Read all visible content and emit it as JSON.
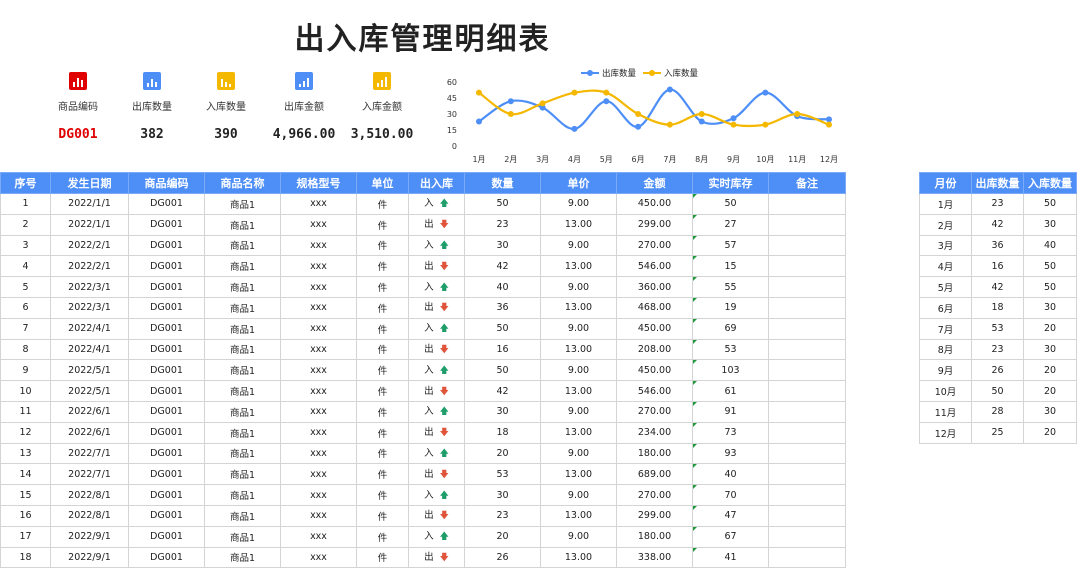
{
  "title": "出入库管理明细表",
  "kpis": [
    {
      "label": "商品编码",
      "value": "DG001",
      "color": "#e00000"
    },
    {
      "label": "出库数量",
      "value": "382",
      "color": "#4d8ef7"
    },
    {
      "label": "入库数量",
      "value": "390",
      "color": "#f5b800"
    },
    {
      "label": "出库金额",
      "value": "4,966.00",
      "color": "#4d8ef7"
    },
    {
      "label": "入库金额",
      "value": "3,510.00",
      "color": "#f5b800"
    }
  ],
  "chart_data": {
    "type": "line",
    "categories": [
      "1月",
      "2月",
      "3月",
      "4月",
      "5月",
      "6月",
      "7月",
      "8月",
      "9月",
      "10月",
      "11月",
      "12月"
    ],
    "series": [
      {
        "name": "出库数量",
        "color": "#4d8ef7",
        "values": [
          23,
          42,
          36,
          16,
          42,
          18,
          53,
          23,
          26,
          50,
          28,
          25
        ]
      },
      {
        "name": "入库数量",
        "color": "#f5b800",
        "values": [
          50,
          30,
          40,
          50,
          50,
          30,
          20,
          30,
          20,
          20,
          30,
          20
        ]
      }
    ],
    "yticks": [
      "60",
      "45",
      "30",
      "15",
      "0"
    ],
    "ylim": [
      0,
      60
    ],
    "legend": "top"
  },
  "table": {
    "headers": [
      "序号",
      "发生日期",
      "商品编码",
      "商品名称",
      "规格型号",
      "单位",
      "出入库",
      "数量",
      "单价",
      "金额",
      "实时库存",
      "备注"
    ],
    "rows": [
      [
        "1",
        "2022/1/1",
        "DG001",
        "商品1",
        "xxx",
        "件",
        "入",
        "50",
        "9.00",
        "450.00",
        "50",
        ""
      ],
      [
        "2",
        "2022/1/1",
        "DG001",
        "商品1",
        "xxx",
        "件",
        "出",
        "23",
        "13.00",
        "299.00",
        "27",
        ""
      ],
      [
        "3",
        "2022/2/1",
        "DG001",
        "商品1",
        "xxx",
        "件",
        "入",
        "30",
        "9.00",
        "270.00",
        "57",
        ""
      ],
      [
        "4",
        "2022/2/1",
        "DG001",
        "商品1",
        "xxx",
        "件",
        "出",
        "42",
        "13.00",
        "546.00",
        "15",
        ""
      ],
      [
        "5",
        "2022/3/1",
        "DG001",
        "商品1",
        "xxx",
        "件",
        "入",
        "40",
        "9.00",
        "360.00",
        "55",
        ""
      ],
      [
        "6",
        "2022/3/1",
        "DG001",
        "商品1",
        "xxx",
        "件",
        "出",
        "36",
        "13.00",
        "468.00",
        "19",
        ""
      ],
      [
        "7",
        "2022/4/1",
        "DG001",
        "商品1",
        "xxx",
        "件",
        "入",
        "50",
        "9.00",
        "450.00",
        "69",
        ""
      ],
      [
        "8",
        "2022/4/1",
        "DG001",
        "商品1",
        "xxx",
        "件",
        "出",
        "16",
        "13.00",
        "208.00",
        "53",
        ""
      ],
      [
        "9",
        "2022/5/1",
        "DG001",
        "商品1",
        "xxx",
        "件",
        "入",
        "50",
        "9.00",
        "450.00",
        "103",
        ""
      ],
      [
        "10",
        "2022/5/1",
        "DG001",
        "商品1",
        "xxx",
        "件",
        "出",
        "42",
        "13.00",
        "546.00",
        "61",
        ""
      ],
      [
        "11",
        "2022/6/1",
        "DG001",
        "商品1",
        "xxx",
        "件",
        "入",
        "30",
        "9.00",
        "270.00",
        "91",
        ""
      ],
      [
        "12",
        "2022/6/1",
        "DG001",
        "商品1",
        "xxx",
        "件",
        "出",
        "18",
        "13.00",
        "234.00",
        "73",
        ""
      ],
      [
        "13",
        "2022/7/1",
        "DG001",
        "商品1",
        "xxx",
        "件",
        "入",
        "20",
        "9.00",
        "180.00",
        "93",
        ""
      ],
      [
        "14",
        "2022/7/1",
        "DG001",
        "商品1",
        "xxx",
        "件",
        "出",
        "53",
        "13.00",
        "689.00",
        "40",
        ""
      ],
      [
        "15",
        "2022/8/1",
        "DG001",
        "商品1",
        "xxx",
        "件",
        "入",
        "30",
        "9.00",
        "270.00",
        "70",
        ""
      ],
      [
        "16",
        "2022/8/1",
        "DG001",
        "商品1",
        "xxx",
        "件",
        "出",
        "23",
        "13.00",
        "299.00",
        "47",
        ""
      ],
      [
        "17",
        "2022/9/1",
        "DG001",
        "商品1",
        "xxx",
        "件",
        "入",
        "20",
        "9.00",
        "180.00",
        "67",
        ""
      ],
      [
        "18",
        "2022/9/1",
        "DG001",
        "商品1",
        "xxx",
        "件",
        "出",
        "26",
        "13.00",
        "338.00",
        "41",
        ""
      ]
    ]
  },
  "monthly": {
    "headers": [
      "月份",
      "出库数量",
      "入库数量"
    ],
    "rows": [
      [
        "1月",
        "23",
        "50"
      ],
      [
        "2月",
        "42",
        "30"
      ],
      [
        "3月",
        "36",
        "40"
      ],
      [
        "4月",
        "16",
        "50"
      ],
      [
        "5月",
        "42",
        "50"
      ],
      [
        "6月",
        "18",
        "30"
      ],
      [
        "7月",
        "53",
        "20"
      ],
      [
        "8月",
        "23",
        "30"
      ],
      [
        "9月",
        "26",
        "20"
      ],
      [
        "10月",
        "50",
        "20"
      ],
      [
        "11月",
        "28",
        "30"
      ],
      [
        "12月",
        "25",
        "20"
      ]
    ]
  },
  "icons": {
    "up": "arrow-up-icon",
    "down": "arrow-down-icon"
  },
  "arrows": {
    "up": "🡅",
    "down": "🡇"
  }
}
